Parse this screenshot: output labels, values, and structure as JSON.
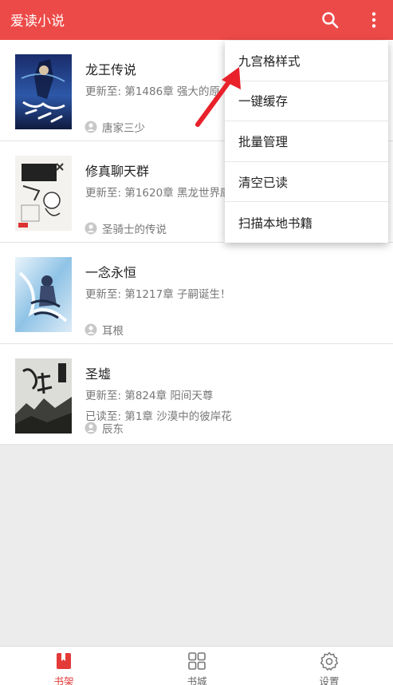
{
  "app": {
    "title": "爱读小说"
  },
  "books": [
    {
      "title": "龙王传说",
      "update": "更新至: 第1486章 强大的原",
      "read": "",
      "author": "唐家三少"
    },
    {
      "title": "修真聊天群",
      "update": "更新至: 第1620章 黑龙世界康",
      "read": "",
      "author": "圣骑士的传说"
    },
    {
      "title": "一念永恒",
      "update": "更新至: 第1217章 子嗣诞生！",
      "read": "",
      "author": "耳根"
    },
    {
      "title": "圣墟",
      "update": "更新至: 第824章 阳间天尊",
      "read": "已读至: 第1章 沙漠中的彼岸花",
      "author": "辰东"
    }
  ],
  "menu": {
    "items": [
      "九宫格样式",
      "一键缓存",
      "批量管理",
      "清空已读",
      "扫描本地书籍"
    ]
  },
  "bottom_nav": [
    {
      "label": "书架",
      "icon": "bookshelf-icon",
      "active": true
    },
    {
      "label": "书城",
      "icon": "grid-store-icon",
      "active": false
    },
    {
      "label": "设置",
      "icon": "gear-icon",
      "active": false
    }
  ],
  "colors": {
    "accent": "#ec4a48",
    "annotation_arrow": "#e8212a"
  }
}
